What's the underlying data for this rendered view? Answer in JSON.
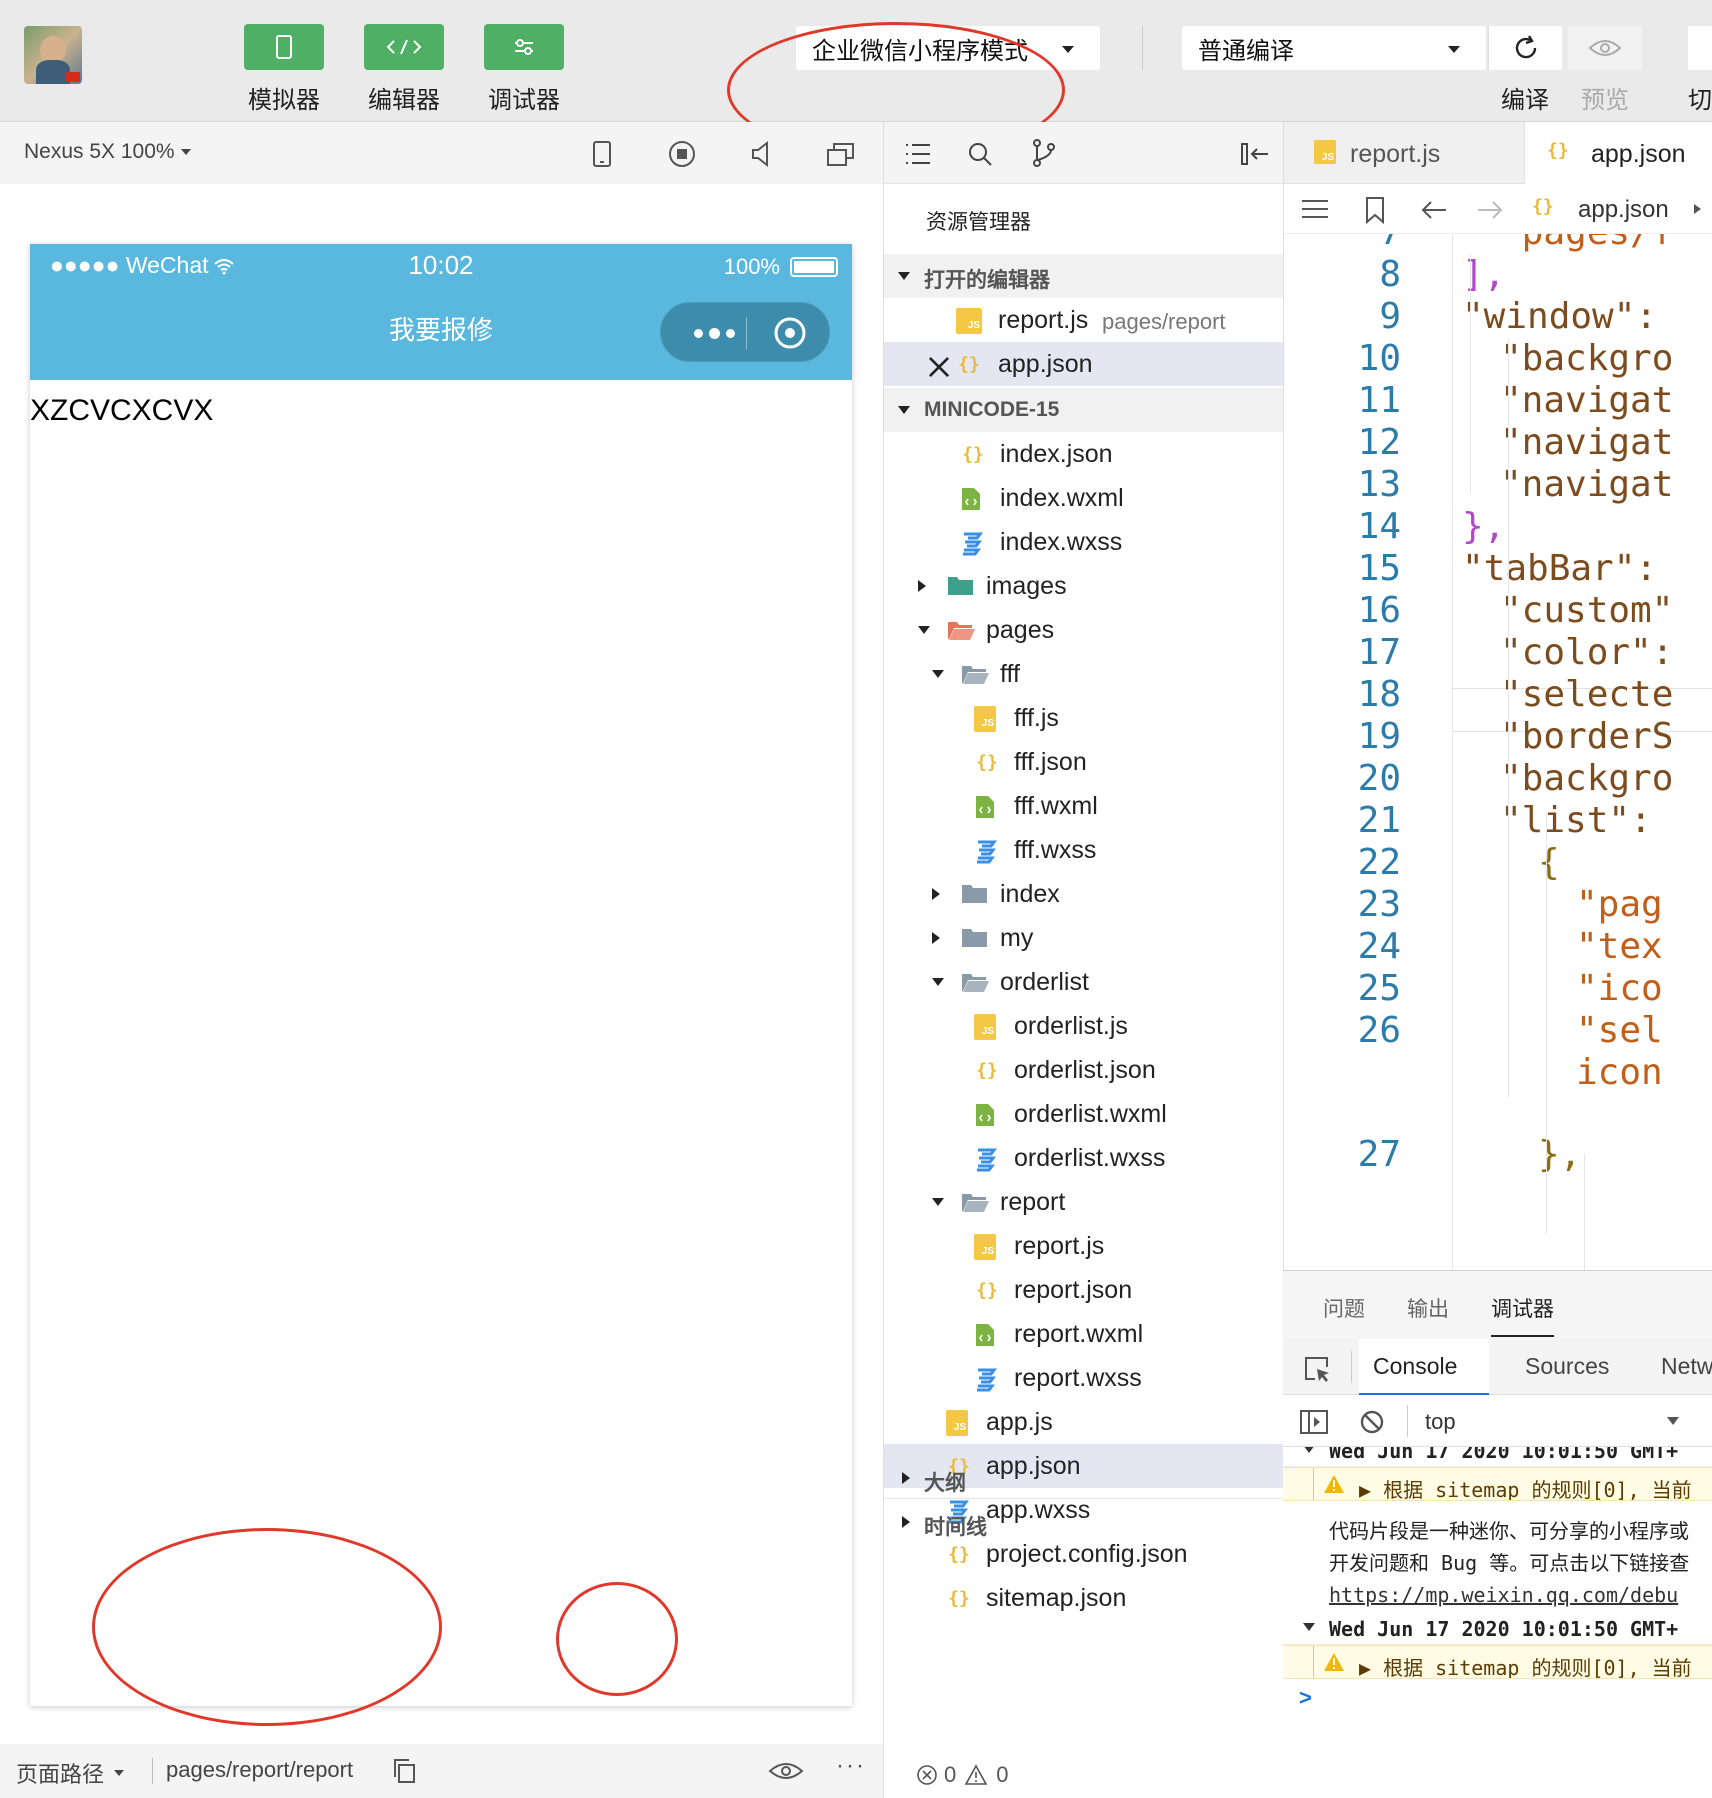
{
  "toolbar": {
    "simulator_label": "模拟器",
    "editor_label": "编辑器",
    "debugger_label": "调试器",
    "mode_select": "企业微信小程序模式",
    "compile_select": "普通编译",
    "compile_label": "编译",
    "preview_label": "预览",
    "switch_label": "切"
  },
  "simulator": {
    "device": "Nexus 5X 100%",
    "status_carrier": "●●●●● WeChat",
    "status_time": "10:02",
    "status_battery": "100%",
    "nav_title": "我要报修",
    "page_text": "XZCVCXCVX",
    "page_path_label": "页面路径",
    "page_path": "pages/report/report"
  },
  "explorer": {
    "title": "资源管理器",
    "open_editors_title": "打开的编辑器",
    "open_editors": [
      {
        "name": "report.js",
        "path": "pages/report"
      },
      {
        "name": "app.json",
        "path": ""
      }
    ],
    "project_title": "MINICODE-15",
    "files": [
      "index.json",
      "index.wxml",
      "index.wxss",
      "images",
      "pages",
      "fff",
      "fff.js",
      "fff.json",
      "fff.wxml",
      "fff.wxss",
      "index",
      "my",
      "orderlist",
      "orderlist.js",
      "orderlist.json",
      "orderlist.wxml",
      "orderlist.wxss",
      "report",
      "report.js",
      "report.json",
      "report.wxml",
      "report.wxss",
      "app.js",
      "app.json",
      "app.wxss",
      "project.config.json",
      "sitemap.json"
    ],
    "outline_title": "大纲",
    "timeline_title": "时间线",
    "errors": "0",
    "warnings": "0"
  },
  "editor": {
    "tabs": [
      "report.js",
      "app.json"
    ],
    "breadcrumb": "app.json",
    "lines": [
      {
        "no": "7",
        "text": "\"pages/f"
      },
      {
        "no": "8",
        "text": "],"
      },
      {
        "no": "9",
        "text": "\"window\":"
      },
      {
        "no": "10",
        "text": "\"backgro"
      },
      {
        "no": "11",
        "text": "\"navigat"
      },
      {
        "no": "12",
        "text": "\"navigat"
      },
      {
        "no": "13",
        "text": "\"navigat"
      },
      {
        "no": "14",
        "text": "},"
      },
      {
        "no": "15",
        "text": "\"tabBar\":"
      },
      {
        "no": "16",
        "text": "\"custom\""
      },
      {
        "no": "17",
        "text": "\"color\":"
      },
      {
        "no": "18",
        "text": "\"selecte"
      },
      {
        "no": "19",
        "text": "\"borderS"
      },
      {
        "no": "20",
        "text": "\"backgro"
      },
      {
        "no": "21",
        "text": "\"list\":"
      },
      {
        "no": "22",
        "text": "{"
      },
      {
        "no": "23",
        "text": "\"pag"
      },
      {
        "no": "24",
        "text": "\"tex"
      },
      {
        "no": "25",
        "text": "\"ico"
      },
      {
        "no": "26",
        "text": "\"sel"
      },
      {
        "no": "",
        "text": "icon"
      },
      {
        "no": "27",
        "text": "},"
      }
    ]
  },
  "debug": {
    "tabs": [
      "问题",
      "输出",
      "调试器"
    ],
    "devtools_tabs": [
      "Console",
      "Sources",
      "Netw"
    ],
    "context": "top",
    "log": [
      {
        "type": "group",
        "text": "Wed Jun 17 2020 10:01:50 GMT+"
      },
      {
        "type": "warn",
        "text": "▶ 根据 sitemap 的规则[0], 当前"
      },
      {
        "type": "info",
        "text": "代码片段是一种迷你、可分享的小程序或"
      },
      {
        "type": "info",
        "text": "开发问题和 Bug 等。可点击以下链接查"
      },
      {
        "type": "link",
        "text": "https://mp.weixin.qq.com/debu"
      },
      {
        "type": "group",
        "text": "Wed Jun 17 2020 10:01:50 GMT+"
      },
      {
        "type": "warn",
        "text": "▶ 根据 sitemap 的规则[0], 当前"
      }
    ],
    "prompt": ">"
  },
  "colors": {
    "accent_green": "#4fb065",
    "nav_blue": "#5ab8de",
    "annotation_red": "#e0392b"
  }
}
